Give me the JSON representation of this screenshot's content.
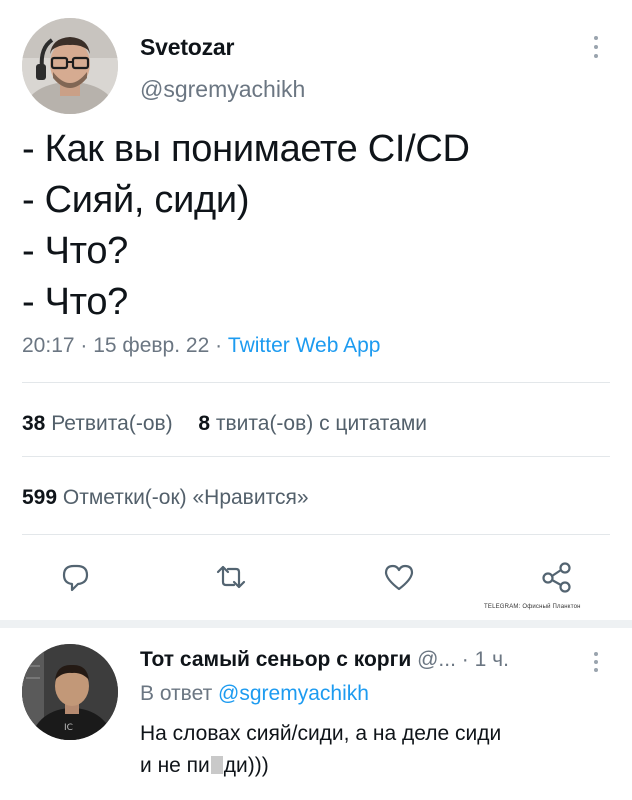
{
  "tweet": {
    "author": {
      "name": "Svetozar",
      "handle": "@sgremyachikh"
    },
    "lines": [
      "- Как вы понимаете CI/CD",
      "- Сияй, сиди)",
      "- Что?",
      "- Что?"
    ],
    "time": "20:17",
    "date": "15 февр. 22",
    "sep": " · ",
    "app": "Twitter Web App",
    "retweets": {
      "count": "38",
      "label": "Ретвита(-ов)"
    },
    "quotes": {
      "count": "8",
      "label": "твита(-ов) с цитатами"
    },
    "likes": {
      "count": "599",
      "label": "Отметки(-ок) «Нравится»"
    },
    "actions": [
      "reply-icon",
      "retweet-icon",
      "like-icon",
      "share-icon"
    ]
  },
  "watermark": "TELEGRAM: Офисный Планктон",
  "reply": {
    "name": "Тот самый сеньор с корги",
    "handle": "@...",
    "time": "1 ч.",
    "reply_to_label": "В ответ",
    "reply_to_handle": "@sgremyachikh",
    "line1": "На словах сияй/сиди, а на деле сиди",
    "line2_start": "и не пи",
    "line2_end": "ди)))"
  },
  "colors": {
    "accent": "#1d9bf0",
    "muted": "#6b7682",
    "text": "#0f1419"
  }
}
